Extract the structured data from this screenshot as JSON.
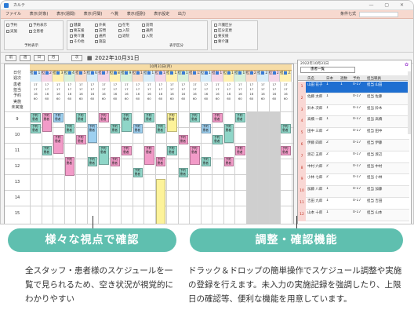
{
  "window": {
    "title": "カルテ"
  },
  "menu": {
    "items": [
      "ファイル",
      "表示(対象)",
      "表示(週間)",
      "表示(月間)",
      "ヘ覧",
      "表示(個別)",
      "表示設定",
      "出力"
    ],
    "condition_label": "条件七式"
  },
  "filters": {
    "col1": [
      "予約",
      "実施"
    ],
    "col2": [
      "予約表示",
      "全患者"
    ],
    "col3": [
      "健康",
      "要支援",
      "要介護",
      "その他"
    ],
    "col4": [
      "外来",
      "訪問",
      "通所",
      "施設"
    ],
    "col5": [
      "在宅",
      "入院",
      "退院"
    ],
    "col6": [
      "訪問",
      "通所",
      "入院"
    ],
    "col7": [
      "介護区分",
      "区分変更",
      "要支援",
      "要介護"
    ],
    "caption1": "予約表示",
    "caption2": "表示区分"
  },
  "nav": {
    "buttons": [
      "前",
      "週",
      "日",
      "月",
      "次"
    ],
    "date": "2022年10月31日"
  },
  "grid": {
    "day_header": "10月31日(月)",
    "rows": [
      "日付",
      "週次",
      "患者",
      "担当",
      "予約",
      "実施",
      "未実施"
    ],
    "times": [
      "9",
      "10",
      "11",
      "12",
      "13",
      "14",
      "15"
    ]
  },
  "right": {
    "title": "2022年10月31日",
    "combo": "患者一覧",
    "headers": [
      "氏名",
      "日本",
      "週数",
      "予約",
      "担当職員"
    ],
    "rows": [
      {
        "no": "1",
        "name": "山田 花子",
        "a": "1",
        "b": "1",
        "c": "0-17",
        "d": "担当 山田"
      },
      {
        "no": "2",
        "name": "佐藤 太郎",
        "a": "1",
        "b": "",
        "c": "0-17",
        "d": "担当 佐藤"
      },
      {
        "no": "3",
        "name": "鈴木 次郎",
        "a": "1",
        "b": "",
        "c": "0-17",
        "d": "担当 鈴木"
      },
      {
        "no": "4",
        "name": "高橋 一郎",
        "a": "1",
        "b": "",
        "c": "0-17",
        "d": "担当 高橋"
      },
      {
        "no": "5",
        "name": "田中 三郎",
        "a": "2",
        "b": "",
        "c": "0-17",
        "d": "担当 田中"
      },
      {
        "no": "6",
        "name": "伊藤 四郎",
        "a": "2",
        "b": "",
        "c": "0-17",
        "d": "担当 伊藤"
      },
      {
        "no": "7",
        "name": "渡辺 五郎",
        "a": "2",
        "b": "",
        "c": "0-17",
        "d": "担当 渡辺"
      },
      {
        "no": "8",
        "name": "中村 六郎",
        "a": "2",
        "b": "",
        "c": "0-17",
        "d": "担当 中村"
      },
      {
        "no": "9",
        "name": "小林 七郎",
        "a": "2",
        "b": "",
        "c": "0-17",
        "d": "担当 小林"
      },
      {
        "no": "10",
        "name": "加藤 八郎",
        "a": "1",
        "b": "",
        "c": "0-17",
        "d": "担当 加藤"
      },
      {
        "no": "11",
        "name": "吉田 九郎",
        "a": "1",
        "b": "",
        "c": "0-17",
        "d": "担当 吉田"
      },
      {
        "no": "12",
        "name": "山本 十郎",
        "a": "1",
        "b": "",
        "c": "0-17",
        "d": "担当 山本"
      }
    ]
  },
  "features": [
    {
      "title": "様々な視点で確認",
      "desc": "全スタッフ・患者様のスケジュールを一覧で見られるため、空き状況が視覚的にわかりやすい"
    },
    {
      "title": "調整・確認機能",
      "desc": "ドラック＆ドロップの簡単操作でスケジュール調整や実施の登録を行えます。未入力の実施記録を強調したり、上限日の確認等、便利な機能を用意しています。"
    }
  ]
}
